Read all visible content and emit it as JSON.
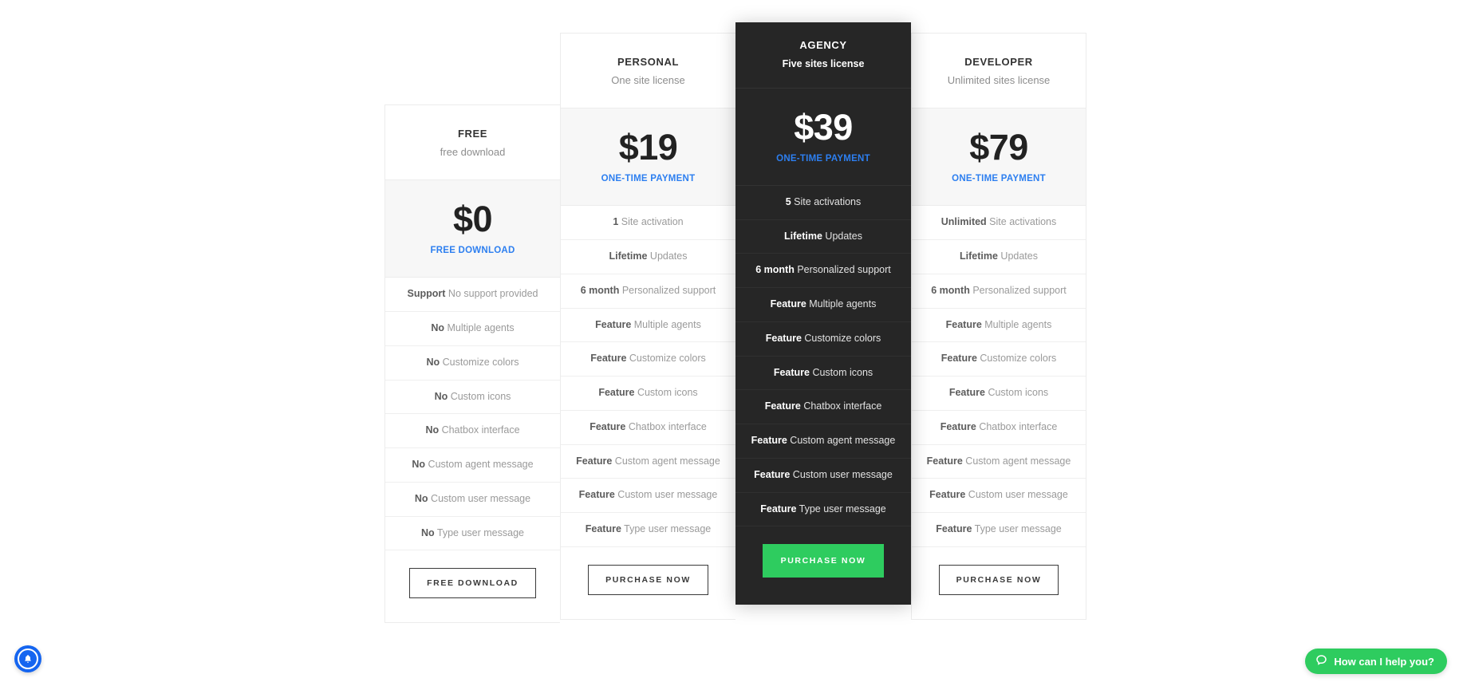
{
  "widgets": {
    "notification": {
      "icon": "bell-icon"
    },
    "help": {
      "icon": "chat-bubble-icon",
      "label": "How can I help you?"
    }
  },
  "plans": [
    {
      "id": "free",
      "name": "FREE",
      "subtitle": "free download",
      "price": "$0",
      "price_note": "FREE DOWNLOAD",
      "cta": "FREE DOWNLOAD",
      "cta_style": "outline",
      "features": [
        {
          "strong": "Support",
          "text": "No support provided"
        },
        {
          "strong": "No",
          "text": "Multiple agents"
        },
        {
          "strong": "No",
          "text": "Customize colors"
        },
        {
          "strong": "No",
          "text": "Custom icons"
        },
        {
          "strong": "No",
          "text": "Chatbox interface"
        },
        {
          "strong": "No",
          "text": "Custom agent message"
        },
        {
          "strong": "No",
          "text": "Custom user message"
        },
        {
          "strong": "No",
          "text": "Type user message"
        }
      ]
    },
    {
      "id": "personal",
      "name": "PERSONAL",
      "subtitle": "One site license",
      "price": "$19",
      "price_note": "ONE-TIME PAYMENT",
      "cta": "PURCHASE NOW",
      "cta_style": "outline",
      "features": [
        {
          "strong": "1",
          "text": "Site activation"
        },
        {
          "strong": "Lifetime",
          "text": "Updates"
        },
        {
          "strong": "6 month",
          "text": "Personalized support"
        },
        {
          "strong": "Feature",
          "text": "Multiple agents"
        },
        {
          "strong": "Feature",
          "text": "Customize colors"
        },
        {
          "strong": "Feature",
          "text": "Custom icons"
        },
        {
          "strong": "Feature",
          "text": "Chatbox interface"
        },
        {
          "strong": "Feature",
          "text": "Custom agent message"
        },
        {
          "strong": "Feature",
          "text": "Custom user message"
        },
        {
          "strong": "Feature",
          "text": "Type user message"
        }
      ]
    },
    {
      "id": "agency",
      "name": "AGENCY",
      "subtitle": "Five sites license",
      "price": "$39",
      "price_note": "ONE-TIME PAYMENT",
      "cta": "PURCHASE NOW",
      "cta_style": "green",
      "features": [
        {
          "strong": "5",
          "text": "Site activations"
        },
        {
          "strong": "Lifetime",
          "text": "Updates"
        },
        {
          "strong": "6 month",
          "text": "Personalized support"
        },
        {
          "strong": "Feature",
          "text": "Multiple agents"
        },
        {
          "strong": "Feature",
          "text": "Customize colors"
        },
        {
          "strong": "Feature",
          "text": "Custom icons"
        },
        {
          "strong": "Feature",
          "text": "Chatbox interface"
        },
        {
          "strong": "Feature",
          "text": "Custom agent message"
        },
        {
          "strong": "Feature",
          "text": "Custom user message"
        },
        {
          "strong": "Feature",
          "text": "Type user message"
        }
      ]
    },
    {
      "id": "developer",
      "name": "DEVELOPER",
      "subtitle": "Unlimited sites license",
      "price": "$79",
      "price_note": "ONE-TIME PAYMENT",
      "cta": "PURCHASE NOW",
      "cta_style": "outline",
      "features": [
        {
          "strong": "Unlimited",
          "text": "Site activations"
        },
        {
          "strong": "Lifetime",
          "text": "Updates"
        },
        {
          "strong": "6 month",
          "text": "Personalized support"
        },
        {
          "strong": "Feature",
          "text": "Multiple agents"
        },
        {
          "strong": "Feature",
          "text": "Customize colors"
        },
        {
          "strong": "Feature",
          "text": "Custom icons"
        },
        {
          "strong": "Feature",
          "text": "Chatbox interface"
        },
        {
          "strong": "Feature",
          "text": "Custom agent message"
        },
        {
          "strong": "Feature",
          "text": "Custom user message"
        },
        {
          "strong": "Feature",
          "text": "Type user message"
        }
      ]
    }
  ],
  "colors": {
    "accent_blue": "#2d7ff0",
    "accent_green": "#2ecc5f",
    "featured_bg": "#262626",
    "price_bg": "#f7f7f7",
    "notification_blue": "#1565f0"
  }
}
